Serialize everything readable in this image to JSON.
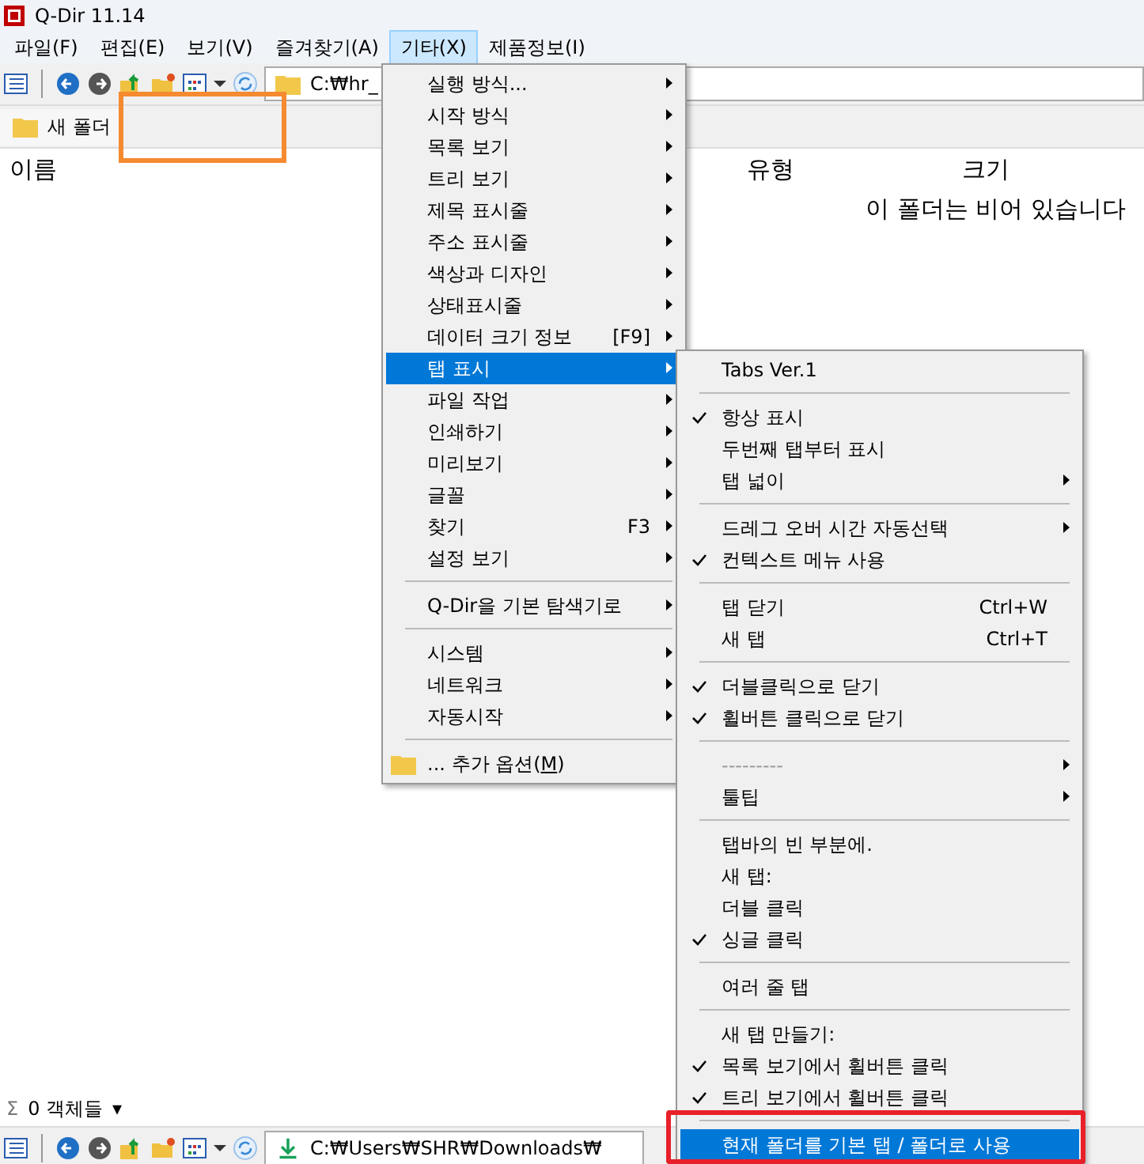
{
  "window": {
    "title": "Q-Dir 11.14"
  },
  "menubar": [
    {
      "label": "파일(F)",
      "selected": false
    },
    {
      "label": "편집(E)",
      "selected": false
    },
    {
      "label": "보기(V)",
      "selected": false
    },
    {
      "label": "즐겨찾기(A)",
      "selected": false
    },
    {
      "label": "기타(X)",
      "selected": true
    },
    {
      "label": "제품정보(I)",
      "selected": false
    }
  ],
  "top_pane": {
    "address": "C:₩hr_",
    "tab": "새 폴더",
    "columns": [
      "이름",
      "유형",
      "크기"
    ],
    "empty_message": "이 폴더는 비어 있습니다"
  },
  "status_bar": {
    "sigma": "Σ",
    "count": "0 객체들",
    "caret": "▾"
  },
  "bottom_pane": {
    "address": "C:₩Users₩SHR₩Downloads₩"
  },
  "menu": [
    {
      "kind": "item",
      "label": "실행 방식...",
      "submenu": true,
      "selected": false
    },
    {
      "kind": "item",
      "label": "시작 방식",
      "submenu": true,
      "selected": false
    },
    {
      "kind": "item",
      "label": "목록 보기",
      "submenu": true,
      "selected": false
    },
    {
      "kind": "item",
      "label": "트리 보기",
      "submenu": true,
      "selected": false
    },
    {
      "kind": "item",
      "label": "제목 표시줄",
      "submenu": true,
      "selected": false
    },
    {
      "kind": "item",
      "label": "주소 표시줄",
      "submenu": true,
      "selected": false
    },
    {
      "kind": "item",
      "label": "색상과 디자인",
      "submenu": true,
      "selected": false
    },
    {
      "kind": "item",
      "label": "상태표시줄",
      "submenu": true,
      "selected": false
    },
    {
      "kind": "item",
      "label": "데이터 크기 정보",
      "shortcut": "[F9]",
      "submenu": true,
      "selected": false
    },
    {
      "kind": "item",
      "label": "탭 표시",
      "submenu": true,
      "selected": true
    },
    {
      "kind": "item",
      "label": "파일 작업",
      "submenu": true,
      "selected": false
    },
    {
      "kind": "item",
      "label": "인쇄하기",
      "submenu": true,
      "selected": false
    },
    {
      "kind": "item",
      "label": "미리보기",
      "submenu": true,
      "selected": false
    },
    {
      "kind": "item",
      "label": "글꼴",
      "submenu": true,
      "selected": false
    },
    {
      "kind": "item",
      "label": "찾기",
      "shortcut": "F3",
      "submenu": true,
      "selected": false
    },
    {
      "kind": "item",
      "label": "설정 보기",
      "submenu": true,
      "selected": false
    },
    {
      "kind": "separator"
    },
    {
      "kind": "item",
      "label": "Q-Dir을 기본 탐색기로",
      "submenu": true,
      "selected": false
    },
    {
      "kind": "separator"
    },
    {
      "kind": "item",
      "label": "시스템",
      "submenu": true,
      "selected": false
    },
    {
      "kind": "item",
      "label": "네트워크",
      "submenu": true,
      "selected": false
    },
    {
      "kind": "item",
      "label": "자동시작",
      "submenu": true,
      "selected": false
    },
    {
      "kind": "separator"
    },
    {
      "kind": "folder",
      "label": "... 추가 옵션(",
      "mnemonic": "M",
      "label_end": ")",
      "submenu": false,
      "selected": false
    }
  ],
  "submenu": [
    {
      "kind": "item",
      "label": "Tabs Ver.1",
      "checked": false,
      "submenu": false,
      "selected": false
    },
    {
      "kind": "separator"
    },
    {
      "kind": "item",
      "label": "항상 표시",
      "checked": true,
      "submenu": false,
      "selected": false
    },
    {
      "kind": "item",
      "label": "두번째 탭부터 표시",
      "checked": false,
      "submenu": false,
      "selected": false
    },
    {
      "kind": "item",
      "label": "탭 넓이",
      "checked": false,
      "submenu": true,
      "selected": false
    },
    {
      "kind": "separator"
    },
    {
      "kind": "item",
      "label": "드레그 오버 시간 자동선택",
      "checked": false,
      "submenu": true,
      "selected": false
    },
    {
      "kind": "item",
      "label": "컨텍스트 메뉴 사용",
      "checked": true,
      "submenu": false,
      "selected": false
    },
    {
      "kind": "separator"
    },
    {
      "kind": "item",
      "label": "탭 닫기",
      "shortcut": "Ctrl+W",
      "checked": false,
      "submenu": false,
      "selected": false
    },
    {
      "kind": "item",
      "label": "새 탭",
      "shortcut": "Ctrl+T",
      "checked": false,
      "submenu": false,
      "selected": false
    },
    {
      "kind": "separator"
    },
    {
      "kind": "item",
      "label": "더블클릭으로 닫기",
      "checked": true,
      "submenu": false,
      "selected": false
    },
    {
      "kind": "item",
      "label": "휠버튼 클릭으로 닫기",
      "checked": true,
      "submenu": false,
      "selected": false
    },
    {
      "kind": "separator"
    },
    {
      "kind": "dashes",
      "label": "---------",
      "checked": false,
      "submenu": true,
      "selected": false
    },
    {
      "kind": "item",
      "label": "툴팁",
      "checked": false,
      "submenu": true,
      "selected": false
    },
    {
      "kind": "separator"
    },
    {
      "kind": "item",
      "label": "탭바의 빈 부분에.",
      "checked": false,
      "submenu": false,
      "selected": false
    },
    {
      "kind": "item",
      "label": "새 탭:",
      "checked": false,
      "submenu": false,
      "selected": false
    },
    {
      "kind": "item",
      "label": "더블 클릭",
      "checked": false,
      "submenu": false,
      "selected": false
    },
    {
      "kind": "item",
      "label": "싱글 클릭",
      "checked": true,
      "submenu": false,
      "selected": false
    },
    {
      "kind": "separator"
    },
    {
      "kind": "item",
      "label": "여러 줄 탭",
      "checked": false,
      "submenu": false,
      "selected": false
    },
    {
      "kind": "separator"
    },
    {
      "kind": "item",
      "label": "새 탭 만들기:",
      "checked": false,
      "submenu": false,
      "selected": false
    },
    {
      "kind": "item",
      "label": "목록 보기에서 휠버튼 클릭",
      "checked": true,
      "submenu": false,
      "selected": false
    },
    {
      "kind": "item",
      "label": "트리 보기에서 휠버튼 클릭",
      "checked": true,
      "submenu": false,
      "selected": false
    },
    {
      "kind": "separator"
    },
    {
      "kind": "item",
      "label": "현재 폴더를 기본 탭 / 폴더로 사용",
      "checked": false,
      "submenu": false,
      "selected": true
    }
  ]
}
